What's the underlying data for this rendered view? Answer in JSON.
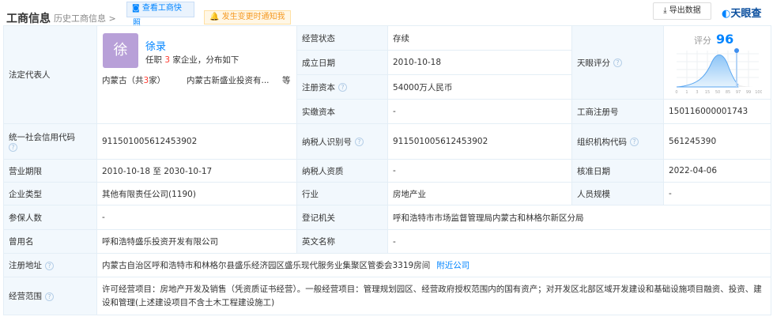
{
  "header": {
    "title": "工商信息",
    "history": "历史工商信息 >",
    "snapshot": "查看工商快照",
    "snapshot_line1": "查看工商快",
    "snapshot_line2": "照",
    "notify": "发生变更时通知我",
    "export": "导出数据",
    "logo": "天眼查"
  },
  "rep": {
    "label": "法定代表人",
    "avatar": "徐",
    "name": "徐录",
    "info_pre": "任职 ",
    "count": "3",
    "info_post": " 家企业，分布如下",
    "region_pre": "内蒙古（共",
    "region_count": "3",
    "region_post": "家）",
    "company": "内蒙古新盛业投资有...",
    "more": "等"
  },
  "score": {
    "label": "天眼评分",
    "title": "评分",
    "value": "96",
    "axis": [
      "0",
      "1",
      "3",
      "15",
      "50",
      "85",
      "97",
      "99",
      "100"
    ]
  },
  "fields": {
    "status_l": "经营状态",
    "status": "存续",
    "founded_l": "成立日期",
    "founded": "2010-10-18",
    "capital_l": "注册资本",
    "capital": "54000万人民币",
    "paid_l": "实缴资本",
    "paid": "-",
    "regno_l": "工商注册号",
    "regno": "150116000001743",
    "credit_l": "统一社会信用代码",
    "credit": "911501005612453902",
    "taxid_l": "纳税人识别号",
    "taxid": "911501005612453902",
    "org_l": "组织机构代码",
    "org": "561245390",
    "term_l": "营业期限",
    "term_from": "2010-10-18",
    "term_to_sep": "至",
    "term_to": "2030-10-17",
    "taxq_l": "纳税人资质",
    "taxq": "-",
    "approve_l": "核准日期",
    "approve": "2022-04-06",
    "type_l": "企业类型",
    "type": "其他有限责任公司(1190)",
    "industry_l": "行业",
    "industry": "房地产业",
    "staff_l": "人员规模",
    "staff": "-",
    "insured_l": "参保人数",
    "insured": "-",
    "authority_l": "登记机关",
    "authority": "呼和浩特市市场监督管理局内蒙古和林格尔新区分局",
    "former_l": "曾用名",
    "former": "呼和浩特盛乐投资开发有限公司",
    "english_l": "英文名称",
    "english": "-",
    "address_l": "注册地址",
    "address": "内蒙古自治区呼和浩特市和林格尔县盛乐经济园区盛乐现代服务业集聚区管委会3319房间",
    "nearby": "附近公司",
    "scope_l": "经营范围",
    "scope": "许可经营项目：房地产开发及销售（凭资质证书经营）。一般经营项目：管理规划园区、经营政府授权范围内的国有资产；对开发区北部区域开发建设和基础设施项目融资、投资、建设和管理(上述建设项目不含土木工程建设施工)"
  }
}
